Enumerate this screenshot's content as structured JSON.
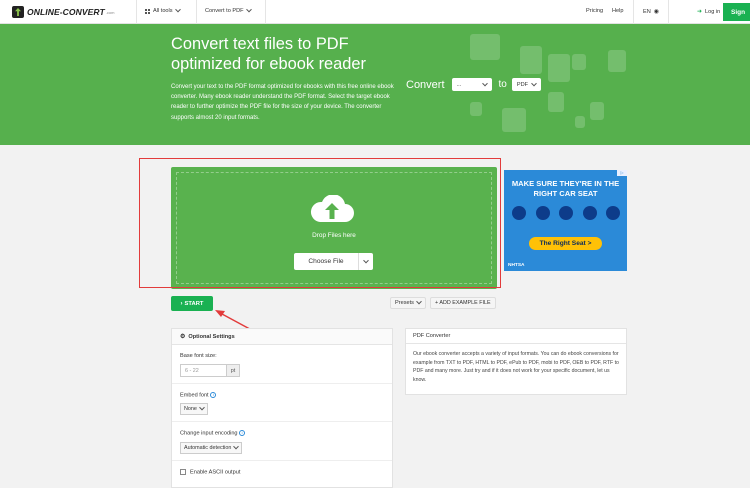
{
  "nav": {
    "logo_text": "ONLINE-CONVERT",
    "logo_suffix": ".com",
    "all_tools": "All tools",
    "convert_to": "Convert to PDF",
    "pricing": "Pricing",
    "help": "Help",
    "lang": "EN",
    "login": "Log in",
    "signup": "Sign"
  },
  "hero": {
    "title": "Convert text files to PDF optimized for ebook reader",
    "description": "Convert your text to the PDF format optimized for ebooks with this free online ebook converter. Many ebook reader understand the PDF format. Select the target ebook reader to further optimize the PDF file for the size of your device. The converter supports almost 20 input formats.",
    "convert_label": "Convert",
    "from_value": "...",
    "to_label": "to",
    "to_value": "PDF"
  },
  "upload": {
    "drop_text": "Drop Files here",
    "choose_label": "Choose File"
  },
  "ad": {
    "headline": "MAKE SURE THEY'RE IN THE RIGHT CAR SEAT",
    "cta": "The Right Seat >",
    "org": "NHTSA"
  },
  "actions": {
    "start": "START",
    "presets": "Presets",
    "add_example": "+ ADD EXAMPLE FILE"
  },
  "settings": {
    "header": "Optional Settings",
    "font_size_label": "Base font size:",
    "font_size_placeholder": "6 - 22",
    "font_size_unit": "pt",
    "embed_font_label": "Embed font",
    "embed_font_value": "None",
    "encoding_label": "Change input encoding",
    "encoding_value": "Automatic detection",
    "ascii_label": "Enable ASCII output"
  },
  "pdf_converter": {
    "header": "PDF Converter",
    "text": "Our ebook converter accepts a variety of input formats. You can do ebook conversions for example from TXT to PDF, HTML to PDF, ePub to PDF, mobi to PDF, OEB to PDF, RTF to PDF and many more. Just try and if it does not work for your specific document, let us know."
  },
  "colors": {
    "brand_green": "#56b04d",
    "button_green": "#1ab152",
    "annotation_red": "#e23b3b",
    "ad_blue": "#2b8ad8"
  }
}
